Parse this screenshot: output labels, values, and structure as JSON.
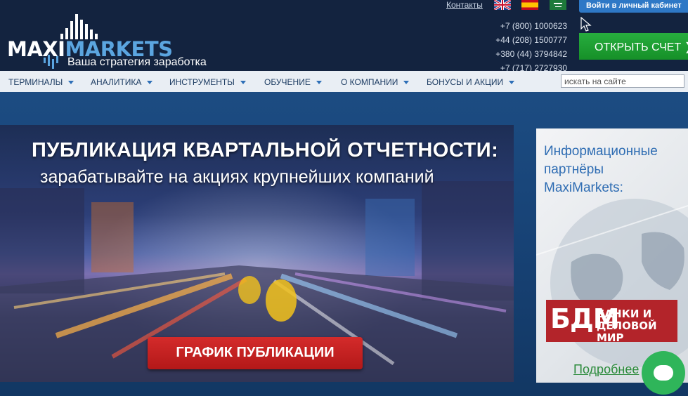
{
  "header": {
    "logo": {
      "part1": "MAXI",
      "part2": "MARKETS",
      "slogan": "Ваша стратегия заработка"
    },
    "contacts_link": "Контакты",
    "flags": [
      "uk-flag-icon",
      "spain-flag-icon",
      "saudi-flag-icon"
    ],
    "phones": [
      "+7 (800) 1000623",
      "+44 (208) 1500777",
      "+380 (44) 3794842",
      "+7 (717) 2727930"
    ],
    "login_button": "Войти в личный кабинет",
    "open_account_button": "ОТКРЫТЬ СЧЕТ",
    "open_account_arrow": "❯"
  },
  "nav": {
    "items": [
      "ТЕРМИНАЛЫ",
      "АНАЛИТИКА",
      "ИНСТРУМЕНТЫ",
      "ОБУЧЕНИЕ",
      "О КОМПАНИИ",
      "БОНУСЫ И АКЦИИ"
    ],
    "search_placeholder": "искать на сайте"
  },
  "banner": {
    "title": "ПУБЛИКАЦИЯ КВАРТАЛЬНОЙ ОТЧЕТНОСТИ:",
    "subtitle": "зарабатывайте на акциях крупнейших компаний",
    "button": "ГРАФИК ПУБЛИКАЦИИ"
  },
  "partners": {
    "title_line1": "Информационные",
    "title_line2": "партнёры",
    "title_line3": "MaxiMarkets:",
    "bdm_big": "БДМ",
    "bdm_line1": "БАНКИ И",
    "bdm_line2": "ДЕЛОВОЙ МИР",
    "more_link": "Подробнее"
  },
  "colors": {
    "header_bg": "#13233f",
    "accent_blue": "#2e78c6",
    "accent_green": "#169028",
    "banner_button": "#c21f1f"
  }
}
